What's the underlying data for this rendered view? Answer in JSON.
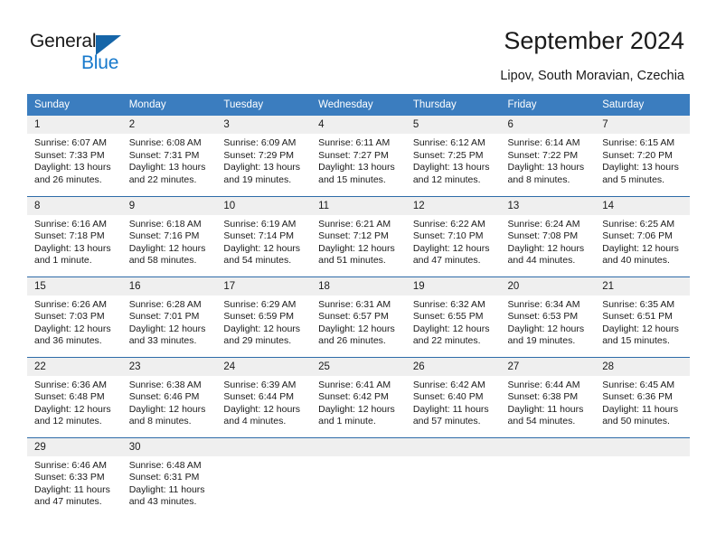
{
  "brand": {
    "name_part1": "General",
    "name_part2": "Blue",
    "triangle_color": "#1565a8",
    "blue_text_color": "#1779cc"
  },
  "header": {
    "title": "September 2024",
    "subtitle": "Lipov, South Moravian, Czechia"
  },
  "theme": {
    "header_row_bg": "#3b7dbf",
    "daynum_bg": "#efefef",
    "cell_border": "#2e6ba8"
  },
  "calendar": {
    "weekday_headers": [
      "Sunday",
      "Monday",
      "Tuesday",
      "Wednesday",
      "Thursday",
      "Friday",
      "Saturday"
    ],
    "weeks": [
      [
        {
          "day": "1",
          "sunrise": "Sunrise: 6:07 AM",
          "sunset": "Sunset: 7:33 PM",
          "daylight_line1": "Daylight: 13 hours",
          "daylight_line2": "and 26 minutes."
        },
        {
          "day": "2",
          "sunrise": "Sunrise: 6:08 AM",
          "sunset": "Sunset: 7:31 PM",
          "daylight_line1": "Daylight: 13 hours",
          "daylight_line2": "and 22 minutes."
        },
        {
          "day": "3",
          "sunrise": "Sunrise: 6:09 AM",
          "sunset": "Sunset: 7:29 PM",
          "daylight_line1": "Daylight: 13 hours",
          "daylight_line2": "and 19 minutes."
        },
        {
          "day": "4",
          "sunrise": "Sunrise: 6:11 AM",
          "sunset": "Sunset: 7:27 PM",
          "daylight_line1": "Daylight: 13 hours",
          "daylight_line2": "and 15 minutes."
        },
        {
          "day": "5",
          "sunrise": "Sunrise: 6:12 AM",
          "sunset": "Sunset: 7:25 PM",
          "daylight_line1": "Daylight: 13 hours",
          "daylight_line2": "and 12 minutes."
        },
        {
          "day": "6",
          "sunrise": "Sunrise: 6:14 AM",
          "sunset": "Sunset: 7:22 PM",
          "daylight_line1": "Daylight: 13 hours",
          "daylight_line2": "and 8 minutes."
        },
        {
          "day": "7",
          "sunrise": "Sunrise: 6:15 AM",
          "sunset": "Sunset: 7:20 PM",
          "daylight_line1": "Daylight: 13 hours",
          "daylight_line2": "and 5 minutes."
        }
      ],
      [
        {
          "day": "8",
          "sunrise": "Sunrise: 6:16 AM",
          "sunset": "Sunset: 7:18 PM",
          "daylight_line1": "Daylight: 13 hours",
          "daylight_line2": "and 1 minute."
        },
        {
          "day": "9",
          "sunrise": "Sunrise: 6:18 AM",
          "sunset": "Sunset: 7:16 PM",
          "daylight_line1": "Daylight: 12 hours",
          "daylight_line2": "and 58 minutes."
        },
        {
          "day": "10",
          "sunrise": "Sunrise: 6:19 AM",
          "sunset": "Sunset: 7:14 PM",
          "daylight_line1": "Daylight: 12 hours",
          "daylight_line2": "and 54 minutes."
        },
        {
          "day": "11",
          "sunrise": "Sunrise: 6:21 AM",
          "sunset": "Sunset: 7:12 PM",
          "daylight_line1": "Daylight: 12 hours",
          "daylight_line2": "and 51 minutes."
        },
        {
          "day": "12",
          "sunrise": "Sunrise: 6:22 AM",
          "sunset": "Sunset: 7:10 PM",
          "daylight_line1": "Daylight: 12 hours",
          "daylight_line2": "and 47 minutes."
        },
        {
          "day": "13",
          "sunrise": "Sunrise: 6:24 AM",
          "sunset": "Sunset: 7:08 PM",
          "daylight_line1": "Daylight: 12 hours",
          "daylight_line2": "and 44 minutes."
        },
        {
          "day": "14",
          "sunrise": "Sunrise: 6:25 AM",
          "sunset": "Sunset: 7:06 PM",
          "daylight_line1": "Daylight: 12 hours",
          "daylight_line2": "and 40 minutes."
        }
      ],
      [
        {
          "day": "15",
          "sunrise": "Sunrise: 6:26 AM",
          "sunset": "Sunset: 7:03 PM",
          "daylight_line1": "Daylight: 12 hours",
          "daylight_line2": "and 36 minutes."
        },
        {
          "day": "16",
          "sunrise": "Sunrise: 6:28 AM",
          "sunset": "Sunset: 7:01 PM",
          "daylight_line1": "Daylight: 12 hours",
          "daylight_line2": "and 33 minutes."
        },
        {
          "day": "17",
          "sunrise": "Sunrise: 6:29 AM",
          "sunset": "Sunset: 6:59 PM",
          "daylight_line1": "Daylight: 12 hours",
          "daylight_line2": "and 29 minutes."
        },
        {
          "day": "18",
          "sunrise": "Sunrise: 6:31 AM",
          "sunset": "Sunset: 6:57 PM",
          "daylight_line1": "Daylight: 12 hours",
          "daylight_line2": "and 26 minutes."
        },
        {
          "day": "19",
          "sunrise": "Sunrise: 6:32 AM",
          "sunset": "Sunset: 6:55 PM",
          "daylight_line1": "Daylight: 12 hours",
          "daylight_line2": "and 22 minutes."
        },
        {
          "day": "20",
          "sunrise": "Sunrise: 6:34 AM",
          "sunset": "Sunset: 6:53 PM",
          "daylight_line1": "Daylight: 12 hours",
          "daylight_line2": "and 19 minutes."
        },
        {
          "day": "21",
          "sunrise": "Sunrise: 6:35 AM",
          "sunset": "Sunset: 6:51 PM",
          "daylight_line1": "Daylight: 12 hours",
          "daylight_line2": "and 15 minutes."
        }
      ],
      [
        {
          "day": "22",
          "sunrise": "Sunrise: 6:36 AM",
          "sunset": "Sunset: 6:48 PM",
          "daylight_line1": "Daylight: 12 hours",
          "daylight_line2": "and 12 minutes."
        },
        {
          "day": "23",
          "sunrise": "Sunrise: 6:38 AM",
          "sunset": "Sunset: 6:46 PM",
          "daylight_line1": "Daylight: 12 hours",
          "daylight_line2": "and 8 minutes."
        },
        {
          "day": "24",
          "sunrise": "Sunrise: 6:39 AM",
          "sunset": "Sunset: 6:44 PM",
          "daylight_line1": "Daylight: 12 hours",
          "daylight_line2": "and 4 minutes."
        },
        {
          "day": "25",
          "sunrise": "Sunrise: 6:41 AM",
          "sunset": "Sunset: 6:42 PM",
          "daylight_line1": "Daylight: 12 hours",
          "daylight_line2": "and 1 minute."
        },
        {
          "day": "26",
          "sunrise": "Sunrise: 6:42 AM",
          "sunset": "Sunset: 6:40 PM",
          "daylight_line1": "Daylight: 11 hours",
          "daylight_line2": "and 57 minutes."
        },
        {
          "day": "27",
          "sunrise": "Sunrise: 6:44 AM",
          "sunset": "Sunset: 6:38 PM",
          "daylight_line1": "Daylight: 11 hours",
          "daylight_line2": "and 54 minutes."
        },
        {
          "day": "28",
          "sunrise": "Sunrise: 6:45 AM",
          "sunset": "Sunset: 6:36 PM",
          "daylight_line1": "Daylight: 11 hours",
          "daylight_line2": "and 50 minutes."
        }
      ],
      [
        {
          "day": "29",
          "sunrise": "Sunrise: 6:46 AM",
          "sunset": "Sunset: 6:33 PM",
          "daylight_line1": "Daylight: 11 hours",
          "daylight_line2": "and 47 minutes."
        },
        {
          "day": "30",
          "sunrise": "Sunrise: 6:48 AM",
          "sunset": "Sunset: 6:31 PM",
          "daylight_line1": "Daylight: 11 hours",
          "daylight_line2": "and 43 minutes."
        },
        {
          "day": "",
          "sunrise": "",
          "sunset": "",
          "daylight_line1": "",
          "daylight_line2": ""
        },
        {
          "day": "",
          "sunrise": "",
          "sunset": "",
          "daylight_line1": "",
          "daylight_line2": ""
        },
        {
          "day": "",
          "sunrise": "",
          "sunset": "",
          "daylight_line1": "",
          "daylight_line2": ""
        },
        {
          "day": "",
          "sunrise": "",
          "sunset": "",
          "daylight_line1": "",
          "daylight_line2": ""
        },
        {
          "day": "",
          "sunrise": "",
          "sunset": "",
          "daylight_line1": "",
          "daylight_line2": ""
        }
      ]
    ]
  }
}
